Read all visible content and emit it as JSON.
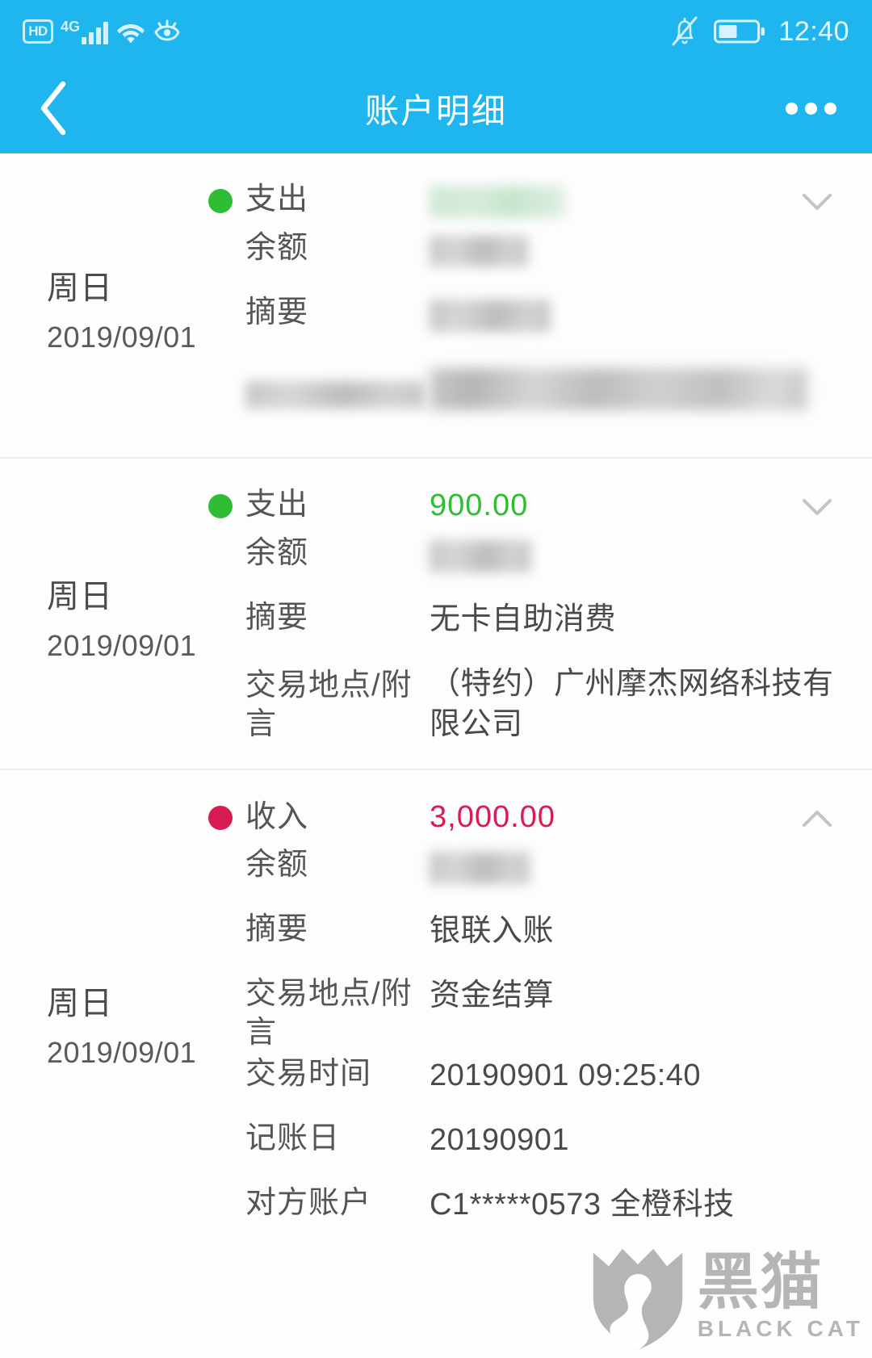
{
  "status_bar": {
    "hd_label": "HD",
    "network_label": "4G",
    "time": "12:40",
    "icons": [
      "hd-icon",
      "signal-bars-icon",
      "wifi-icon",
      "eye-protection-icon",
      "mute-bell-icon",
      "battery-icon"
    ]
  },
  "nav": {
    "title": "账户明细",
    "back_icon": "chevron-left-icon",
    "more_icon": "more-options-icon"
  },
  "labels": {
    "expense": "支出",
    "income": "收入",
    "balance": "余额",
    "summary": "摘要",
    "place_memo": "交易地点/附言",
    "txn_time": "交易时间",
    "post_date": "记账日",
    "counterparty": "对方账户"
  },
  "colors": {
    "brand_blue": "#1fb6f0",
    "expense_green": "#2ebd35",
    "income_red": "#d81b52",
    "label_gray": "#555555",
    "divider": "#eceef0"
  },
  "transactions": [
    {
      "weekday": "周日",
      "date": "2019/09/01",
      "type_label": "支出",
      "type_color": "green",
      "amount": "",
      "amount_redacted": true,
      "expanded": false,
      "chevron": "chevron-down-icon",
      "rows": [
        {
          "label": "余额",
          "value": "",
          "redacted": true
        },
        {
          "label": "摘要",
          "value": "",
          "redacted": true
        },
        {
          "label": "",
          "value": "",
          "redacted": true,
          "label_redacted": true
        }
      ]
    },
    {
      "weekday": "周日",
      "date": "2019/09/01",
      "type_label": "支出",
      "type_color": "green",
      "amount": "900.00",
      "amount_redacted": false,
      "expanded": false,
      "chevron": "chevron-down-icon",
      "rows": [
        {
          "label": "余额",
          "value": "",
          "redacted": true
        },
        {
          "label": "摘要",
          "value": "无卡自助消费",
          "redacted": false
        },
        {
          "label": "交易地点/附言",
          "value": "（特约）广州摩杰网络科技有限公司",
          "redacted": false
        }
      ]
    },
    {
      "weekday": "周日",
      "date": "2019/09/01",
      "type_label": "收入",
      "type_color": "red",
      "amount": "3,000.00",
      "amount_redacted": false,
      "expanded": true,
      "chevron": "chevron-up-icon",
      "rows": [
        {
          "label": "余额",
          "value": "",
          "redacted": true
        },
        {
          "label": "摘要",
          "value": "银联入账",
          "redacted": false
        },
        {
          "label": "交易地点/附言",
          "value": "资金结算",
          "redacted": false
        },
        {
          "label": "交易时间",
          "value": "20190901 09:25:40",
          "redacted": false
        },
        {
          "label": "记账日",
          "value": "20190901",
          "redacted": false
        },
        {
          "label": "对方账户",
          "value": "C1*****0573 全橙科技",
          "redacted": false
        }
      ]
    }
  ],
  "watermark": {
    "cn": "黑猫",
    "en": "BLACK CAT",
    "icon": "black-cat-shield-logo"
  }
}
